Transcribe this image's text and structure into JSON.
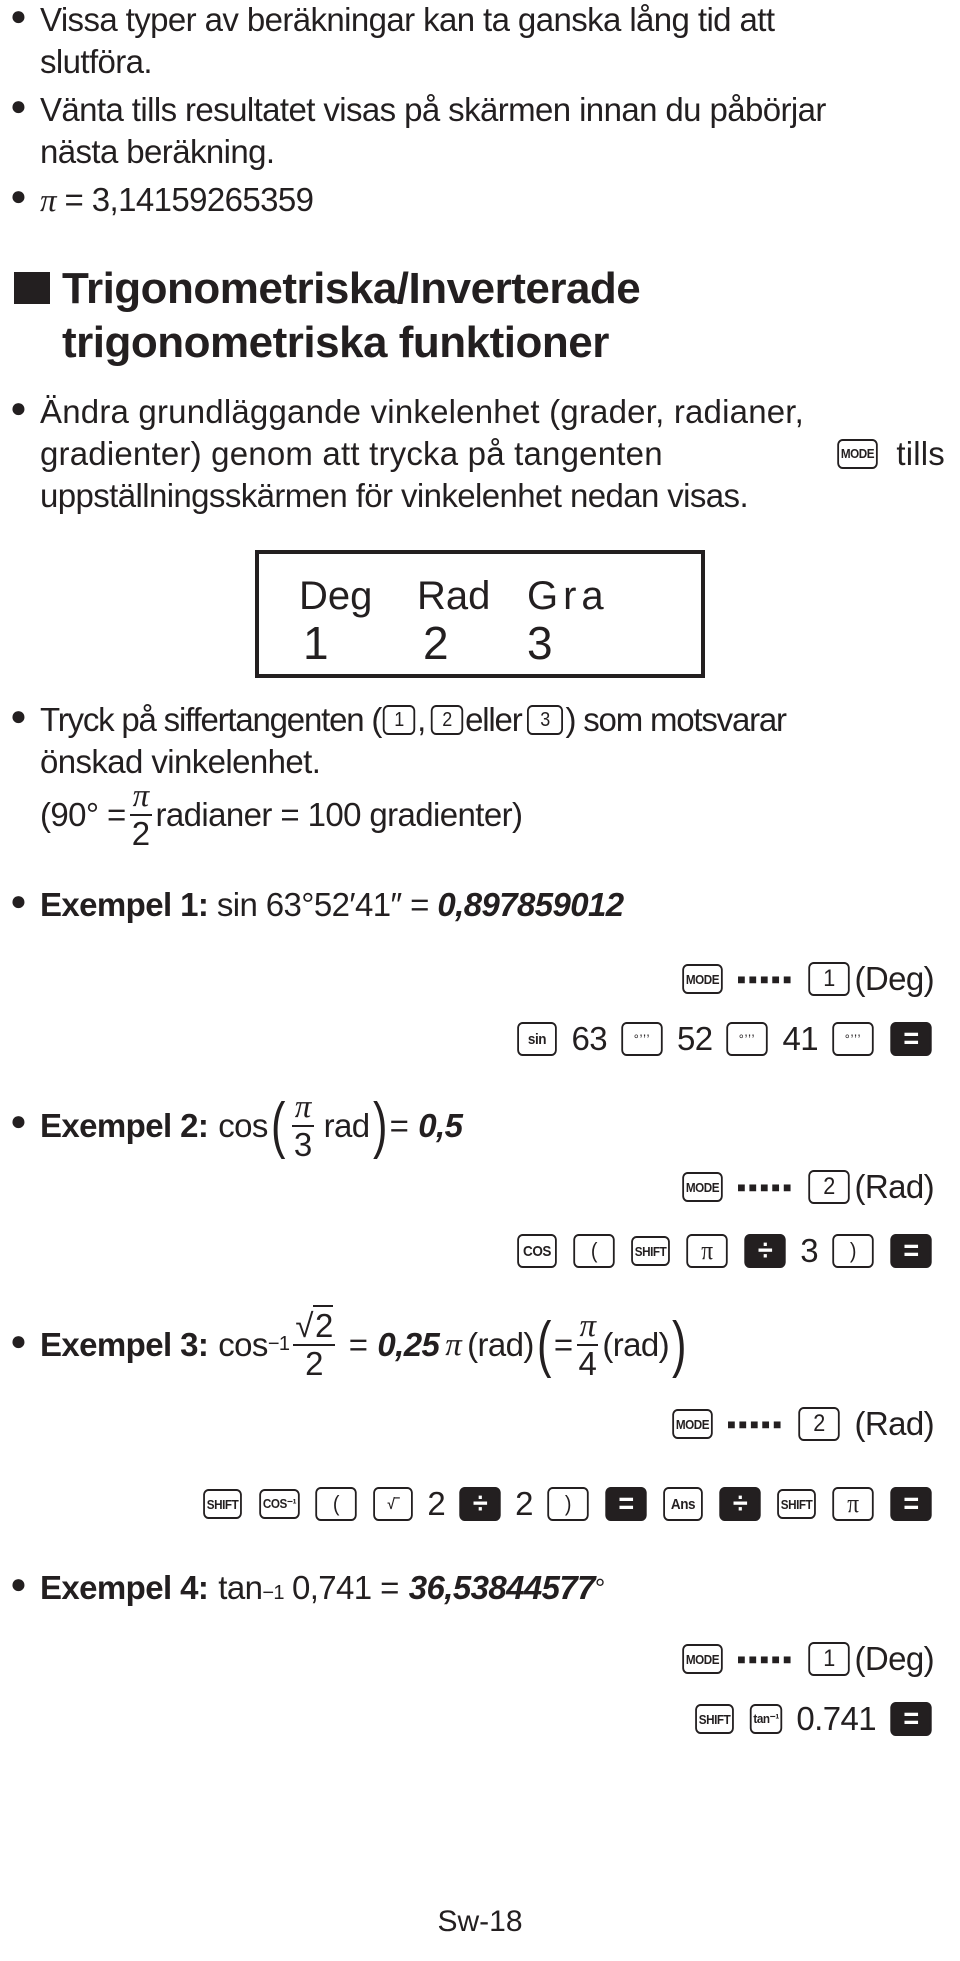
{
  "intro_bullets": [
    {
      "line1": "Vissa typer av beräkningar kan ta ganska lång tid att",
      "line2": "slutföra."
    },
    {
      "line1": "Vänta tills resultatet visas på skärmen innan du påbörjar",
      "line2": "nästa beräkning."
    },
    {
      "pi_symbol": "π",
      "text": " = 3,14159265359"
    }
  ],
  "heading": {
    "line1": "Trigonometriska/Inverterade",
    "line2": "trigonometriska funktioner"
  },
  "angle_bullet": {
    "line1": "Ändra grundläggande vinkelenhet (grader, radianer,",
    "line2a": "gradienter) genom att trycka på tangenten",
    "mode_key": "MODE",
    "line2b": "tills",
    "line3": "uppställningsskärmen för vinkelenhet nedan visas."
  },
  "display": {
    "labels": [
      "Deg",
      "Rad",
      "Gra"
    ],
    "numbers": [
      "1",
      "2",
      "3"
    ]
  },
  "digit_bullet": {
    "text_a": "Tryck på siffertangenten (",
    "key1": "1",
    "comma": ",",
    "key2": "2",
    "text_or": "eller",
    "key3": "3",
    "text_b": ") som motsvarar",
    "line2": "önskad vinkelenhet.",
    "eq_open": "(90° =",
    "frac_num": "π",
    "frac_den": "2",
    "eq_rest": "radianer = 100 gradienter)"
  },
  "examples": [
    {
      "label": "Exempel 1:",
      "expr": "sin 63°52′41″ =",
      "result": "0,897859012",
      "mode_row": {
        "mode_key": "MODE",
        "dots": "■■■■■",
        "digit_key": "1",
        "unit": "(Deg)"
      },
      "keys": [
        {
          "type": "key",
          "label": "sin"
        },
        {
          "type": "text",
          "label": "63"
        },
        {
          "type": "key",
          "label": "°’’’"
        },
        {
          "type": "text",
          "label": "52"
        },
        {
          "type": "key",
          "label": "°’’’"
        },
        {
          "type": "text",
          "label": "41"
        },
        {
          "type": "key",
          "label": "°’’’"
        },
        {
          "type": "dark",
          "label": "="
        }
      ]
    },
    {
      "label": "Exempel 2:",
      "expr_a": "cos",
      "frac_num": "π",
      "frac_den": "3",
      "expr_b": "rad",
      "eq": "=",
      "result": "0,5",
      "mode_row": {
        "mode_key": "MODE",
        "dots": "■■■■■",
        "digit_key": "2",
        "unit": "(Rad)"
      },
      "keys": [
        {
          "type": "key",
          "label": "COS"
        },
        {
          "type": "key",
          "label": "("
        },
        {
          "type": "key",
          "label": "SHIFT"
        },
        {
          "type": "key",
          "label": "π"
        },
        {
          "type": "dark",
          "label": "÷"
        },
        {
          "type": "text",
          "label": "3"
        },
        {
          "type": "key",
          "label": ")"
        },
        {
          "type": "dark",
          "label": "="
        }
      ]
    },
    {
      "label": "Exempel 3:",
      "expr_a": "cos",
      "sup": "−1",
      "frac_num": "√2",
      "frac_den": "2",
      "eq": "=",
      "result": "0,25",
      "pi": "π",
      "unit": "(rad)",
      "eq2": "=",
      "frac2_num": "π",
      "frac2_den": "4",
      "unit2": "(rad)",
      "mode_row": {
        "mode_key": "MODE",
        "dots": "■■■■■",
        "digit_key": "2",
        "unit": "(Rad)"
      },
      "keys": [
        {
          "type": "key",
          "label": "SHIFT"
        },
        {
          "type": "key",
          "label": "COS⁻¹"
        },
        {
          "type": "key",
          "label": "("
        },
        {
          "type": "key",
          "label": "√‾"
        },
        {
          "type": "text",
          "label": "2"
        },
        {
          "type": "dark",
          "label": "÷"
        },
        {
          "type": "text",
          "label": "2"
        },
        {
          "type": "key",
          "label": ")"
        },
        {
          "type": "dark",
          "label": "="
        },
        {
          "type": "key",
          "label": "Ans"
        },
        {
          "type": "dark",
          "label": "÷"
        },
        {
          "type": "key",
          "label": "SHIFT"
        },
        {
          "type": "key",
          "label": "π"
        },
        {
          "type": "dark",
          "label": "="
        }
      ]
    },
    {
      "label": "Exempel 4:",
      "expr_a": "tan",
      "sup": "−1",
      "expr_b": "0,741 =",
      "result": "36,53844577",
      "degree": "°",
      "mode_row": {
        "mode_key": "MODE",
        "dots": "■■■■■",
        "digit_key": "1",
        "unit": "(Deg)"
      },
      "keys": [
        {
          "type": "key",
          "label": "SHIFT"
        },
        {
          "type": "key",
          "label": "tan⁻¹"
        },
        {
          "type": "text",
          "label": "0.741"
        },
        {
          "type": "dark",
          "label": "="
        }
      ]
    }
  ],
  "footer": {
    "page_number": "Sw-18"
  }
}
